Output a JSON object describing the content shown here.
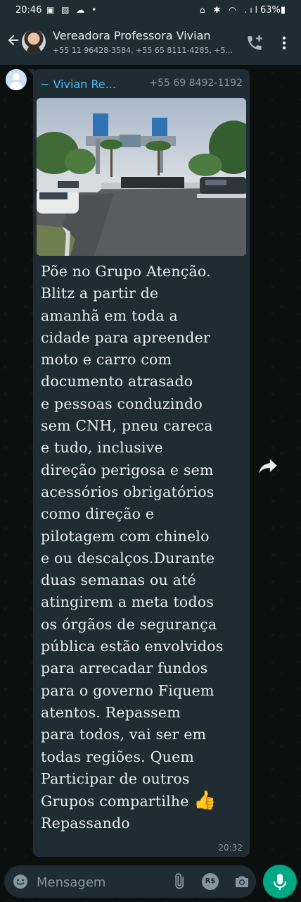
{
  "status_bar": {
    "time": "20:46",
    "left_icons": "▣ ▨ ☁ •",
    "right_icons": "⌂ ✱ ◠ .ıl",
    "battery": "63%▮"
  },
  "header": {
    "back_label": "←",
    "contact_name": "Vereadora Professora Vivian",
    "contact_subtitle": "+55 11 96428-3584, +55 65 8111-4285, +5..."
  },
  "message": {
    "sender_name": "~ Vivian Re...",
    "sender_phone": "+55 69 8492-1192",
    "text": "Põe no Grupo Atenção.\nBlitz a partir de\namanhã em toda a\ncidade para apreender\nmoto e carro com\ndocumento atrasado\ne pessoas conduzindo\nsem CNH, pneu careca\ne tudo, inclusive\ndireção perigosa e sem\nacessórios obrigatórios\ncomo direção e\npilotagem com chinelo\ne ou descalços.Durante\nduas semanas ou até\natingirem a meta todos\nos  órgãos de segurança\npública estão envolvidos\npara arrecadar fundos\npara o governo  Fiquem\natentos. Repassem\npara todos, vai ser em\ntodas regiões. Quem\nParticipar de outros\nGrupos compartilhe",
    "emoji": "👍",
    "text_end": "Repassando",
    "time": "20:32"
  },
  "input": {
    "placeholder": "Mensagem",
    "rs_label": "R$"
  },
  "colors": {
    "header_bg": "#1f2c34",
    "bubble_bg": "#1f2c34",
    "sender_name": "#53bdeb",
    "accent_green": "#00a884"
  },
  "icons": [
    "back-arrow-icon",
    "add-call-icon",
    "more-vert-icon",
    "forward-icon",
    "emoji-icon",
    "attach-icon",
    "currency-icon",
    "camera-icon",
    "mic-icon"
  ]
}
